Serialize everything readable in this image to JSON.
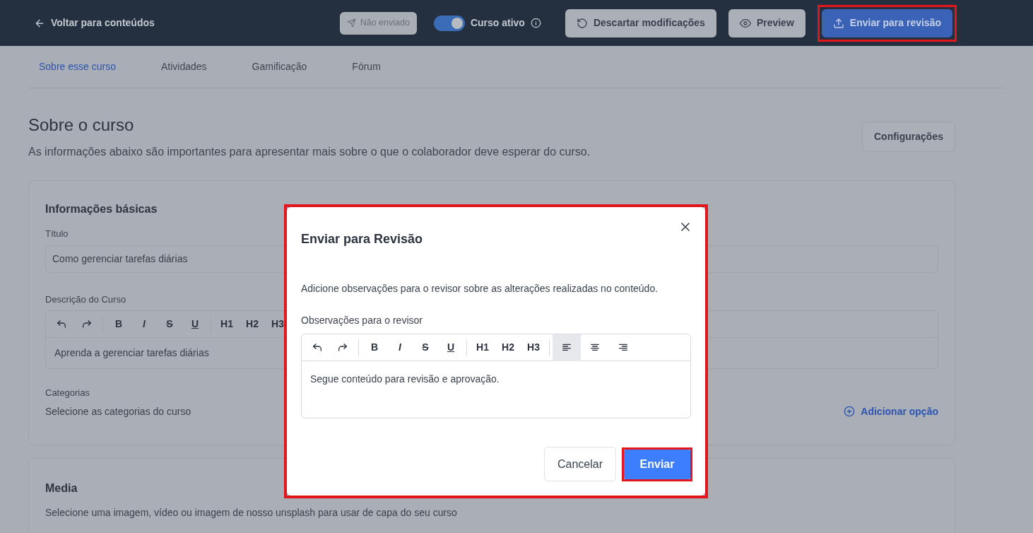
{
  "header": {
    "back_link": "Voltar para conteúdos",
    "status_badge": "Não enviado",
    "active_toggle": {
      "label": "Curso ativo",
      "on": true
    },
    "buttons": [
      {
        "label": "Descartar modificações",
        "kind": "discard",
        "highlighted": false
      },
      {
        "label": "Preview",
        "kind": "preview",
        "highlighted": false
      },
      {
        "label": "Enviar para revisão",
        "kind": "submit",
        "highlighted": true
      }
    ]
  },
  "tabs": [
    {
      "label": "Sobre esse curso",
      "selected": true
    },
    {
      "label": "Atividades",
      "selected": false
    },
    {
      "label": "Gamificação",
      "selected": false
    },
    {
      "label": "Fórum",
      "selected": false
    }
  ],
  "page": {
    "title": "Sobre o curso",
    "subtitle": "As informações abaixo são importantes para apresentar mais sobre o que o colaborador deve esperar do curso.",
    "settings_button": "Configurações"
  },
  "basic_info": {
    "title": "Informações básicas",
    "fields": [
      {
        "label": "Título",
        "kind": "input",
        "value": "Como gerenciar tarefas diárias"
      },
      {
        "label": "Descrição do Curso",
        "kind": "editor",
        "toolbar": [
          "B",
          "I",
          "S",
          "U",
          "H1",
          "H2",
          "H3"
        ],
        "value": "Aprenda a gerenciar tarefas diárias"
      }
    ],
    "categories": {
      "label": "Categorias",
      "hint": "Selecione as categorias do curso",
      "add_link": "Adicionar opção"
    }
  },
  "media": {
    "title": "Media",
    "hint": "Selecione uma imagem, vídeo ou imagem de nosso unsplash para usar de capa do seu curso"
  },
  "modal": {
    "title": "Enviar para Revisão",
    "highlighted": true,
    "description": "Adicione observações para o revisor sobre as alterações realizadas no conteúdo.",
    "field_label": "Observações para o revisor",
    "toolbar": [
      "B",
      "I",
      "S",
      "U",
      "H1",
      "H2",
      "H3"
    ],
    "align_buttons": [
      {
        "kind": "left",
        "selected": true
      },
      {
        "kind": "center",
        "selected": false
      },
      {
        "kind": "right",
        "selected": false
      }
    ],
    "value": "Segue conteúdo para revisão e aprovação.",
    "buttons": [
      {
        "label": "Cancelar",
        "kind": "cancel",
        "highlighted": false
      },
      {
        "label": "Enviar",
        "kind": "confirm",
        "highlighted": true
      }
    ]
  }
}
